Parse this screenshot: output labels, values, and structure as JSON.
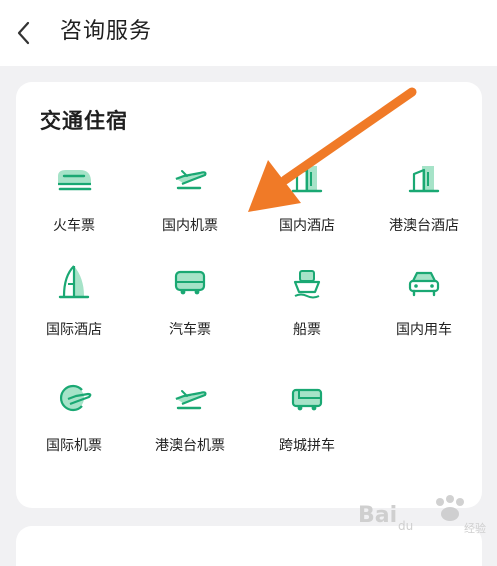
{
  "header": {
    "back_icon": "chevron-left-icon",
    "title": "咨询服务"
  },
  "section": {
    "title": "交通住宿",
    "accent_color": "#1aa873",
    "items": [
      {
        "label": "火车票",
        "icon": "train-icon"
      },
      {
        "label": "国内机票",
        "icon": "airplane-icon"
      },
      {
        "label": "国内酒店",
        "icon": "hotel-building-icon"
      },
      {
        "label": "港澳台酒店",
        "icon": "hotel-building-icon"
      },
      {
        "label": "国际酒店",
        "icon": "sail-hotel-icon"
      },
      {
        "label": "汽车票",
        "icon": "bus-icon"
      },
      {
        "label": "船票",
        "icon": "ship-icon"
      },
      {
        "label": "国内用车",
        "icon": "car-icon"
      },
      {
        "label": "国际机票",
        "icon": "globe-plane-icon"
      },
      {
        "label": "港澳台机票",
        "icon": "airplane-icon"
      },
      {
        "label": "跨城拼车",
        "icon": "intercity-bus-icon"
      }
    ]
  },
  "annotation": {
    "arrow_color": "#f07a27"
  },
  "watermark": {
    "text": "Baidu经验"
  }
}
